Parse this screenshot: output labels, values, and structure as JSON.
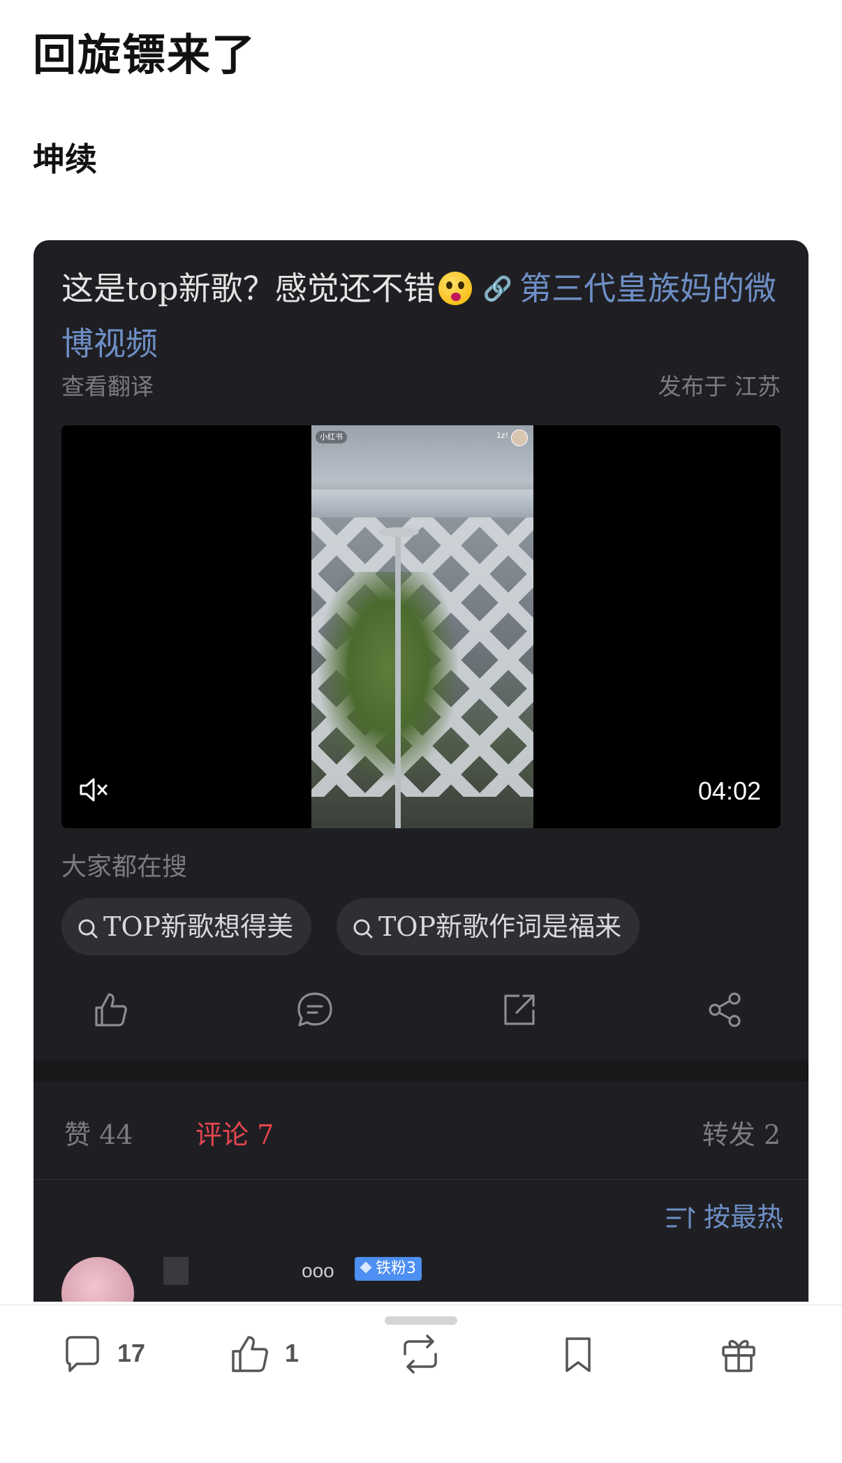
{
  "post": {
    "title": "回旋镖来了",
    "body": "坤续"
  },
  "card": {
    "text": "这是top新歌？感觉还不错",
    "link_text": "第三代皇族妈的微博视频",
    "translate": "查看翻译",
    "location": "发布于 江苏",
    "video": {
      "duration": "04:02",
      "badge_left": "小红书",
      "badge_right": "1z!"
    },
    "search_label": "大家都在搜",
    "search_chips": [
      "TOP新歌想得美",
      "TOP新歌作词是福来"
    ],
    "stats": {
      "likes": "赞 44",
      "comments": "评论 7",
      "reposts": "转发 2"
    },
    "sort_label": "按最热",
    "first_comment": {
      "name_fragment": "ooo",
      "badge": "铁粉3"
    }
  },
  "bottom_bar": {
    "comments_count": "17",
    "likes_count": "1"
  },
  "colors": {
    "card_bg": "#1f1f23",
    "link": "#6e8fc6",
    "active_tab": "#e5464f"
  }
}
